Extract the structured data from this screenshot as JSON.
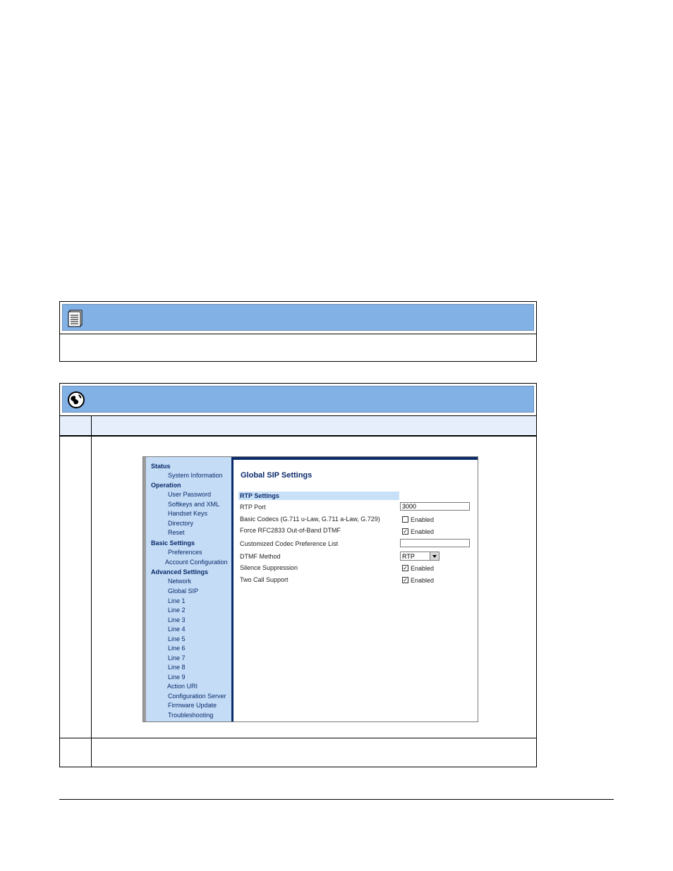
{
  "webui": {
    "sidebar": {
      "groups": [
        {
          "heading": "Status",
          "items": [
            "System Information"
          ]
        },
        {
          "heading": "Operation",
          "items": [
            "User Password",
            "Softkeys and XML",
            "Handset Keys",
            "Directory",
            "Reset"
          ]
        },
        {
          "heading": "Basic Settings",
          "items": [
            "Preferences",
            "Account Configuration"
          ]
        },
        {
          "heading": "Advanced Settings",
          "items": [
            "Network",
            "Global SIP",
            "Line 1",
            "Line 2",
            "Line 3",
            "Line 4",
            "Line 5",
            "Line 6",
            "Line 7",
            "Line 8",
            "Line 9",
            "Action URI",
            "Configuration Server",
            "Firmware Update",
            "Troubleshooting"
          ]
        }
      ]
    },
    "page_title": "Global SIP Settings",
    "section_title": "RTP Settings",
    "fields": {
      "rtp_port_label": "RTP Port",
      "rtp_port_value": "3000",
      "basic_codecs_label": "Basic Codecs (G.711 u-Law, G.711 a-Law, G.729)",
      "basic_codecs_checked": false,
      "force_rfc_label": "Force RFC2833 Out-of-Band DTMF",
      "force_rfc_checked": true,
      "codec_pref_label": "Customized Codec Preference List",
      "codec_pref_value": "",
      "dtmf_label": "DTMF Method",
      "dtmf_value": "RTP",
      "silence_label": "Silence Suppression",
      "silence_checked": true,
      "two_call_label": "Two Call Support",
      "two_call_checked": true,
      "enabled_text": "Enabled"
    },
    "colors": {
      "banner": "#82b1e6",
      "sidebar": "#c4dcf6",
      "nav_text": "#0a2a6a"
    }
  },
  "icons": {
    "note": "notepad-icon",
    "web": "globe-icon"
  }
}
